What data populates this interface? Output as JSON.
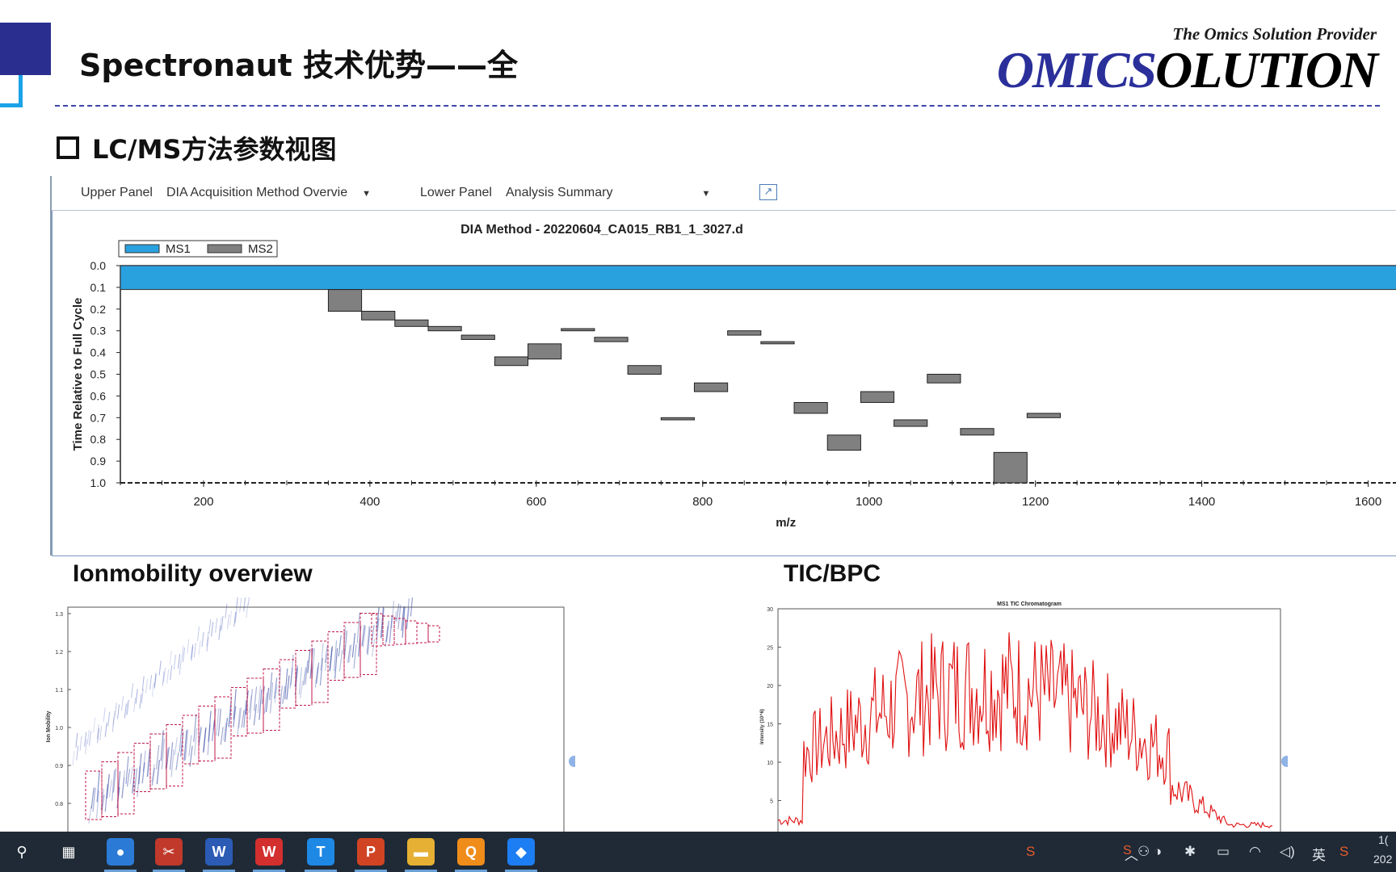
{
  "slide": {
    "title": "Spectronaut 技术优势——全",
    "logo_tagline": "The Omics Solution Provider",
    "logo_part1": "OMICS",
    "logo_part2": "OLUTION",
    "section_heading": "LC/MS方法参数视图",
    "left_subheading": "Ionmobility overview",
    "right_subheading": "TIC/BPC"
  },
  "toolbar": {
    "upper_label": "Upper Panel",
    "upper_value": "DIA Acquisition Method Overvie",
    "lower_label": "Lower Panel",
    "lower_value": "Analysis Summary",
    "popout_icon": "popout-icon"
  },
  "chart_data": [
    {
      "type": "bar",
      "title": "DIA Method - 20220604_CA015_RB1_1_3027.d",
      "xlabel": "m/z",
      "ylabel": "Time Relative to Full Cycle",
      "xticks": [
        200,
        400,
        600,
        800,
        1000,
        1200,
        1400,
        1600
      ],
      "yticks": [
        "0.0",
        "0.1",
        "0.2",
        "0.3",
        "0.4",
        "0.5",
        "0.6",
        "0.7",
        "0.8",
        "0.9",
        "1.0"
      ],
      "xlim": [
        100,
        1650
      ],
      "ylim": [
        0,
        1.0
      ],
      "y_inverted": true,
      "legend": [
        {
          "name": "MS1",
          "color": "#2aa1df"
        },
        {
          "name": "MS2",
          "color": "#808080"
        }
      ],
      "legend_position": "top-left",
      "ms1": {
        "x0": 100,
        "x1": 1650,
        "t0": 0.0,
        "t1": 0.11
      },
      "ms2_windows": [
        {
          "x0": 350,
          "x1": 390,
          "t0": 0.11,
          "t1": 0.21
        },
        {
          "x0": 390,
          "x1": 430,
          "t0": 0.21,
          "t1": 0.25
        },
        {
          "x0": 430,
          "x1": 470,
          "t0": 0.25,
          "t1": 0.28
        },
        {
          "x0": 470,
          "x1": 510,
          "t0": 0.28,
          "t1": 0.3
        },
        {
          "x0": 510,
          "x1": 550,
          "t0": 0.32,
          "t1": 0.34
        },
        {
          "x0": 550,
          "x1": 590,
          "t0": 0.42,
          "t1": 0.46
        },
        {
          "x0": 590,
          "x1": 630,
          "t0": 0.36,
          "t1": 0.43
        },
        {
          "x0": 630,
          "x1": 670,
          "t0": 0.29,
          "t1": 0.3
        },
        {
          "x0": 670,
          "x1": 710,
          "t0": 0.33,
          "t1": 0.35
        },
        {
          "x0": 710,
          "x1": 750,
          "t0": 0.46,
          "t1": 0.5
        },
        {
          "x0": 750,
          "x1": 790,
          "t0": 0.7,
          "t1": 0.71
        },
        {
          "x0": 790,
          "x1": 830,
          "t0": 0.54,
          "t1": 0.58
        },
        {
          "x0": 830,
          "x1": 870,
          "t0": 0.3,
          "t1": 0.32
        },
        {
          "x0": 870,
          "x1": 910,
          "t0": 0.35,
          "t1": 0.36
        },
        {
          "x0": 910,
          "x1": 950,
          "t0": 0.63,
          "t1": 0.68
        },
        {
          "x0": 950,
          "x1": 990,
          "t0": 0.78,
          "t1": 0.85
        },
        {
          "x0": 990,
          "x1": 1030,
          "t0": 0.58,
          "t1": 0.63
        },
        {
          "x0": 1030,
          "x1": 1070,
          "t0": 0.71,
          "t1": 0.74
        },
        {
          "x0": 1070,
          "x1": 1110,
          "t0": 0.5,
          "t1": 0.54
        },
        {
          "x0": 1110,
          "x1": 1150,
          "t0": 0.75,
          "t1": 0.78
        },
        {
          "x0": 1150,
          "x1": 1190,
          "t0": 0.86,
          "t1": 1.0
        },
        {
          "x0": 1190,
          "x1": 1230,
          "t0": 0.68,
          "t1": 0.7
        }
      ]
    },
    {
      "type": "heatmap",
      "ylabel": "Ion Mobility",
      "yticks": [
        "1.3",
        "1.2",
        "1.1",
        "1.0",
        "0.9",
        "0.8"
      ]
    },
    {
      "type": "line",
      "title": "MS1 TIC Chromatogram",
      "ylabel": "Intensity (10^6)",
      "yticks": [
        "30",
        "25",
        "20",
        "15",
        "10",
        "5"
      ],
      "series_color": "#e01010"
    }
  ],
  "taskbar": {
    "apps": [
      {
        "name": "search-icon",
        "glyph": "⚲",
        "color": "#1f2a36"
      },
      {
        "name": "task-view-icon",
        "glyph": "▦",
        "color": "#1f2a36"
      },
      {
        "name": "chrome-icon",
        "glyph": "●",
        "color": "#2b7bd6"
      },
      {
        "name": "snipaste-icon",
        "glyph": "✂",
        "color": "#c0392b"
      },
      {
        "name": "word-icon",
        "glyph": "W",
        "color": "#2b5bb5"
      },
      {
        "name": "wps-icon",
        "glyph": "W",
        "color": "#d32f2f"
      },
      {
        "name": "tencent-meeting-icon",
        "glyph": "T",
        "color": "#1e88e5"
      },
      {
        "name": "powerpoint-icon",
        "glyph": "P",
        "color": "#d04423"
      },
      {
        "name": "file-explorer-icon",
        "glyph": "▬",
        "color": "#e5b033"
      },
      {
        "name": "search-app-icon",
        "glyph": "Q",
        "color": "#f08c1a"
      },
      {
        "name": "feishu-icon",
        "glyph": "◆",
        "color": "#1d7df2"
      }
    ],
    "ime_label": "英",
    "clock_top": "1(",
    "clock_bottom": "202"
  }
}
